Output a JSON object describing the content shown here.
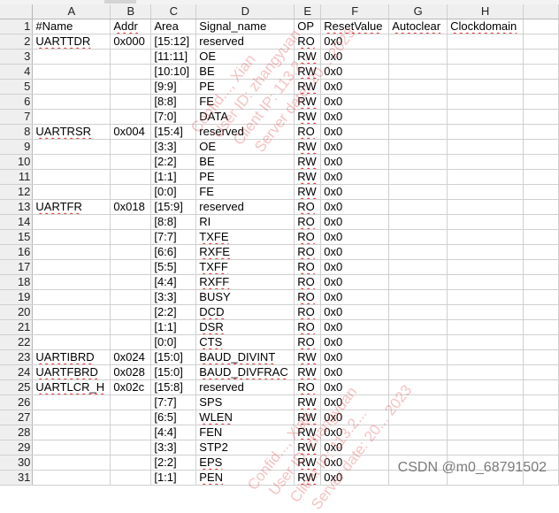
{
  "columns": [
    "A",
    "B",
    "C",
    "D",
    "E",
    "F",
    "G",
    "H"
  ],
  "rows": [
    {
      "n": "1",
      "cells": [
        "#Name",
        "Addr",
        "Area",
        "Signal_name",
        "OP",
        "ResetValue",
        "Autoclear",
        "Clockdomain"
      ]
    },
    {
      "n": "2",
      "cells": [
        "UARTTDR",
        "0x000",
        "[15:12]",
        "reserved",
        "RO",
        "0x0",
        "",
        ""
      ]
    },
    {
      "n": "3",
      "cells": [
        "",
        "",
        "[11:11]",
        "OE",
        "RW",
        "0x0",
        "",
        ""
      ]
    },
    {
      "n": "4",
      "cells": [
        "",
        "",
        "[10:10]",
        "BE",
        "RW",
        "0x0",
        "",
        ""
      ]
    },
    {
      "n": "5",
      "cells": [
        "",
        "",
        "[9:9]",
        "PE",
        "RW",
        "0x0",
        "",
        ""
      ]
    },
    {
      "n": "6",
      "cells": [
        "",
        "",
        "[8:8]",
        "FE",
        "RW",
        "0x0",
        "",
        ""
      ]
    },
    {
      "n": "7",
      "cells": [
        "",
        "",
        "[7:0]",
        "DATA",
        "RW",
        "0x0",
        "",
        ""
      ]
    },
    {
      "n": "8",
      "cells": [
        "UARTRSR",
        "0x004",
        "[15:4]",
        "reserved",
        "RO",
        "0x0",
        "",
        ""
      ]
    },
    {
      "n": "9",
      "cells": [
        "",
        "",
        "[3:3]",
        "OE",
        "RW",
        "0x0",
        "",
        ""
      ]
    },
    {
      "n": "10",
      "cells": [
        "",
        "",
        "[2:2]",
        "BE",
        "RW",
        "0x0",
        "",
        ""
      ]
    },
    {
      "n": "11",
      "cells": [
        "",
        "",
        "[1:1]",
        "PE",
        "RW",
        "0x0",
        "",
        ""
      ]
    },
    {
      "n": "12",
      "cells": [
        "",
        "",
        "[0:0]",
        "FE",
        "RW",
        "0x0",
        "",
        ""
      ]
    },
    {
      "n": "13",
      "cells": [
        "UARTFR",
        "0x018",
        "[15:9]",
        "reserved",
        "RO",
        "0x0",
        "",
        ""
      ]
    },
    {
      "n": "14",
      "cells": [
        "",
        "",
        "[8:8]",
        "RI",
        "RO",
        "0x0",
        "",
        ""
      ]
    },
    {
      "n": "15",
      "cells": [
        "",
        "",
        "[7:7]",
        "TXFE",
        "RO",
        "0x0",
        "",
        ""
      ]
    },
    {
      "n": "16",
      "cells": [
        "",
        "",
        "[6:6]",
        "RXFE",
        "RO",
        "0x0",
        "",
        ""
      ]
    },
    {
      "n": "17",
      "cells": [
        "",
        "",
        "[5:5]",
        "TXFF",
        "RO",
        "0x0",
        "",
        ""
      ]
    },
    {
      "n": "18",
      "cells": [
        "",
        "",
        "[4:4]",
        "RXFF",
        "RO",
        "0x0",
        "",
        ""
      ]
    },
    {
      "n": "19",
      "cells": [
        "",
        "",
        "[3:3]",
        "BUSY",
        "RO",
        "0x0",
        "",
        ""
      ]
    },
    {
      "n": "20",
      "cells": [
        "",
        "",
        "[2:2]",
        "DCD",
        "RO",
        "0x0",
        "",
        ""
      ]
    },
    {
      "n": "21",
      "cells": [
        "",
        "",
        "[1:1]",
        "DSR",
        "RO",
        "0x0",
        "",
        ""
      ]
    },
    {
      "n": "22",
      "cells": [
        "",
        "",
        "[0:0]",
        "CTS",
        "RO",
        "0x0",
        "",
        ""
      ]
    },
    {
      "n": "23",
      "cells": [
        "UARTIBRD",
        "0x024",
        "[15:0]",
        "BAUD_DIVINT",
        "RW",
        "0x0",
        "",
        ""
      ]
    },
    {
      "n": "24",
      "cells": [
        "UARTFBRD",
        "0x028",
        "[15:0]",
        "BAUD_DIVFRAC",
        "RW",
        "0x0",
        "",
        ""
      ]
    },
    {
      "n": "25",
      "cells": [
        "UARTLCR_H",
        "0x02c",
        "[15:8]",
        "reserved",
        "RO",
        "0x0",
        "",
        ""
      ]
    },
    {
      "n": "26",
      "cells": [
        "",
        "",
        "[7:7]",
        "SPS",
        "RW",
        "0x0",
        "",
        ""
      ]
    },
    {
      "n": "27",
      "cells": [
        "",
        "",
        "[6:5]",
        "WLEN",
        "RW",
        "0x0",
        "",
        ""
      ]
    },
    {
      "n": "28",
      "cells": [
        "",
        "",
        "[4:4]",
        "FEN",
        "RW",
        "0x0",
        "",
        ""
      ]
    },
    {
      "n": "29",
      "cells": [
        "",
        "",
        "[3:3]",
        "STP2",
        "RW",
        "0x0",
        "",
        ""
      ]
    },
    {
      "n": "30",
      "cells": [
        "",
        "",
        "[2:2]",
        "EPS",
        "RW",
        "0x0",
        "",
        ""
      ]
    },
    {
      "n": "31",
      "cells": [
        "",
        "",
        "[1:1]",
        "PEN",
        "RW",
        "0x0",
        "",
        ""
      ]
    }
  ],
  "spellcheck_words": [
    "UARTTDR",
    "UARTRSR",
    "UARTFR",
    "UARTIBRD",
    "UARTFBRD",
    "UARTLCR_H",
    "TXFE",
    "RXFE",
    "TXFF",
    "RXFF",
    "DCD",
    "DSR",
    "CTS",
    "BAUD_DIVINT",
    "BAUD_DIVFRAC",
    "WLEN",
    "EPS",
    "PEN",
    "RO",
    "RW",
    "Addr",
    "ResetValue",
    "Autoclear",
    "Clockdomain"
  ],
  "watermark": {
    "color": "#e04646",
    "lines": [
      "Confid..., Xian",
      "User ID: zhangyuan",
      "Client IP: 113.2...",
      "Server date: 20... 2023"
    ]
  },
  "credit": "CSDN @m0_68791502"
}
